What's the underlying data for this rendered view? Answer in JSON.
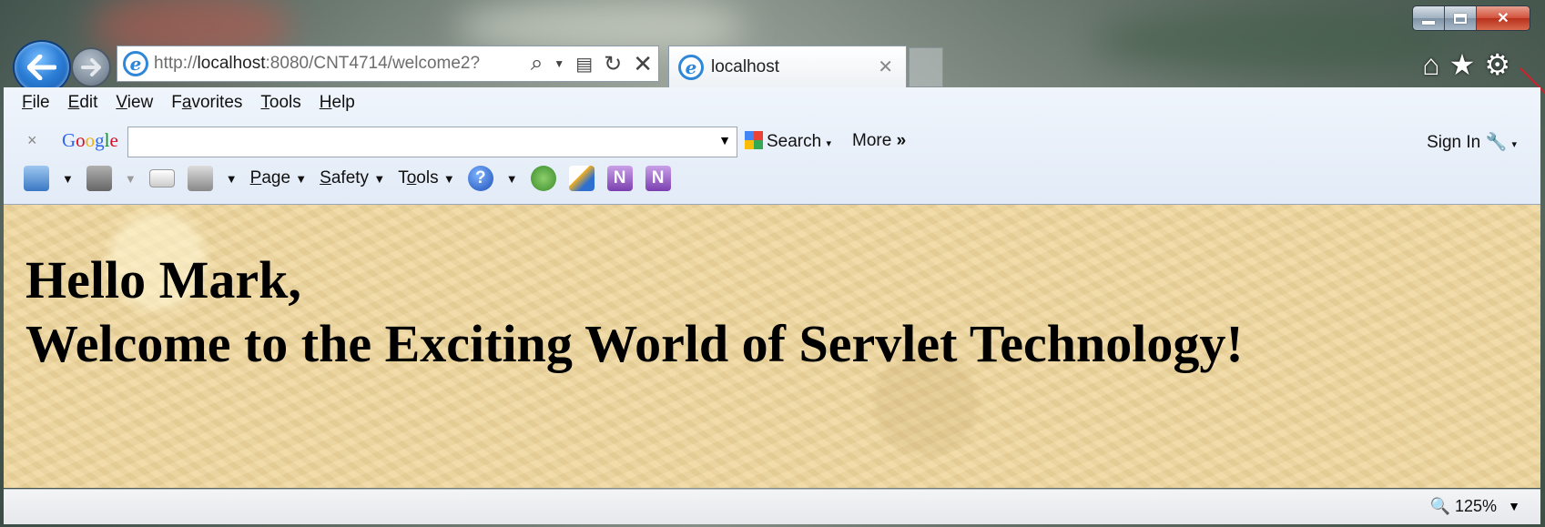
{
  "window": {
    "controls": {
      "minimize": "minimize",
      "maximize": "maximize",
      "close": "close"
    }
  },
  "nav": {
    "url_prefix": "http://",
    "url_host": "localhost",
    "url_rest": ":8080/CNT4714/welcome2?",
    "address_icons": [
      "search-icon",
      "dropdown-icon",
      "compatibility-icon",
      "refresh-icon",
      "stop-icon"
    ],
    "tab_title": "localhost",
    "right_icons": [
      "home-icon",
      "favorites-star-icon",
      "gear-icon"
    ]
  },
  "menu": {
    "items": [
      "File",
      "Edit",
      "View",
      "Favorites",
      "Tools",
      "Help"
    ]
  },
  "google_bar": {
    "close": "×",
    "logo": "Google",
    "search_value": "",
    "search_label": "Search",
    "more_label": "More",
    "sign_in_label": "Sign In"
  },
  "command_bar": {
    "page_label": "Page",
    "safety_label": "Safety",
    "tools_label": "Tools"
  },
  "content": {
    "line1": "Hello Mark,",
    "line2": "Welcome to the Exciting World of Servlet Technology!"
  },
  "status": {
    "zoom": "125%"
  }
}
